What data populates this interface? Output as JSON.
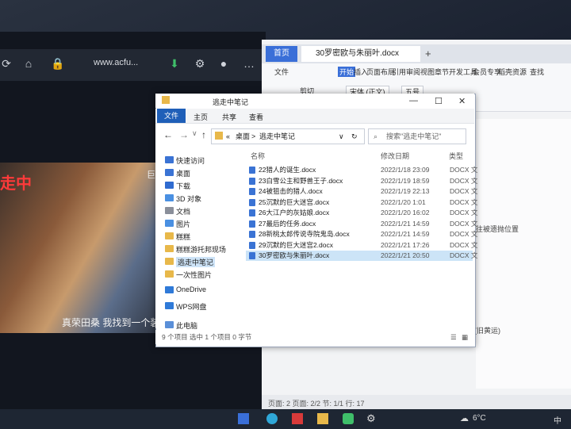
{
  "browser": {
    "url": "www.acfu..."
  },
  "video": {
    "title": "走中",
    "subtitle": "真荣田桑 我找到一个装",
    "side_text": "巨大"
  },
  "wps": {
    "home_tab": "首页",
    "doc_tab": "30罗密欧与朱丽叶.docx",
    "ribbon_menu": [
      "文件",
      "开始",
      "插入",
      "页面布局",
      "引用",
      "审阅",
      "视图",
      "章节",
      "开发工具",
      "会员专享",
      "稻壳资源",
      "查找"
    ],
    "cut": "剪切",
    "font": "宋体 (正文)",
    "size": "五号",
    "side_text_1": "往被遗抛位置",
    "side_text_2": "(旧黄运)",
    "status": "页面: 2   页面: 2/2   节: 1/1   行: 17"
  },
  "explorer": {
    "title": "逃走中笔记",
    "menu": [
      "文件",
      "主页",
      "共享",
      "查看"
    ],
    "address": [
      "«",
      "桌面",
      ">",
      "逃走中笔记"
    ],
    "search_placeholder": "搜索\"逃走中笔记\"",
    "columns": {
      "name": "名称",
      "date": "修改日期",
      "type": "类型"
    },
    "sidebar": [
      {
        "label": "快速访问",
        "color": "#3a73d4"
      },
      {
        "label": "桌面",
        "color": "#3a73d4"
      },
      {
        "label": "下载",
        "color": "#2f6bd0"
      },
      {
        "label": "3D 对象",
        "color": "#4a90e2"
      },
      {
        "label": "文档",
        "color": "#8a8f9a"
      },
      {
        "label": "图片",
        "color": "#4a90e2"
      },
      {
        "label": "糕糕",
        "color": "#e8b84a"
      },
      {
        "label": "糕糕游托邦现场",
        "color": "#e8b84a"
      },
      {
        "label": "逃走中笔记",
        "color": "#e8b84a"
      },
      {
        "label": "一次性图片",
        "color": "#e8b84a"
      },
      {
        "label": "OneDrive",
        "color": "#2f7ad8"
      },
      {
        "label": "WPS网盘",
        "color": "#2f7ad8"
      },
      {
        "label": "此电脑",
        "color": "#5a8fd8"
      }
    ],
    "files": [
      {
        "name": "22猎人的诞生.docx",
        "date": "2022/1/18 23:09",
        "type": "DOCX 文"
      },
      {
        "name": "23白雪公主和野兽王子.docx",
        "date": "2022/1/19 18:59",
        "type": "DOCX 文"
      },
      {
        "name": "24被狙击的猎人.docx",
        "date": "2022/1/19 22:13",
        "type": "DOCX 文"
      },
      {
        "name": "25沉默的巨大迷宫.docx",
        "date": "2022/1/20 1:01",
        "type": "DOCX 文"
      },
      {
        "name": "26大江户的灰姑娘.docx",
        "date": "2022/1/20 16:02",
        "type": "DOCX 文"
      },
      {
        "name": "27最后的任务.docx",
        "date": "2022/1/21 14:59",
        "type": "DOCX 文"
      },
      {
        "name": "28新桃太郎传说寺院鬼岛.docx",
        "date": "2022/1/21 14:59",
        "type": "DOCX 文"
      },
      {
        "name": "29沉默的巨大迷宫2.docx",
        "date": "2022/1/21 17:26",
        "type": "DOCX 文"
      },
      {
        "name": "30罗密欧与朱丽叶.docx",
        "date": "2022/1/21 20:50",
        "type": "DOCX 文"
      }
    ],
    "status": "9 个项目   选中 1 个项目  0 字节"
  },
  "taskbar": {
    "temp": "6°C",
    "lang": "中"
  }
}
